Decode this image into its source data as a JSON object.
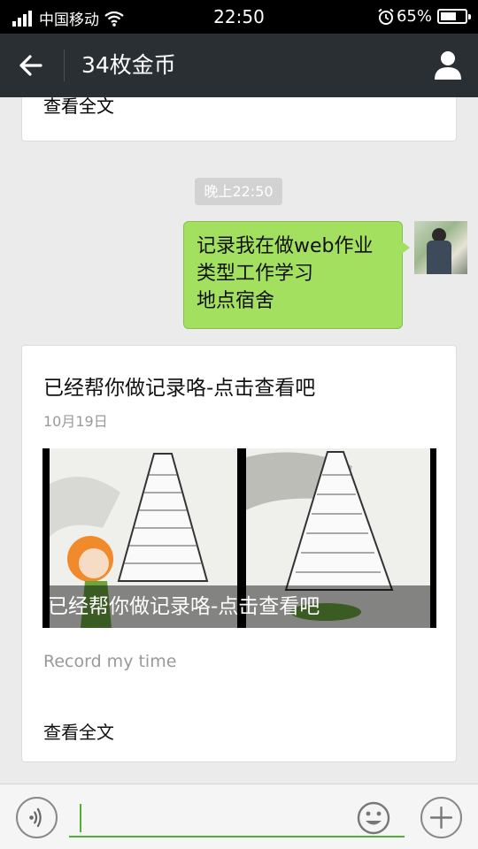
{
  "status_bar": {
    "carrier": "中国移动",
    "time": "22:50",
    "battery": "65%",
    "battery_level": 0.65
  },
  "nav": {
    "title": "34枚金币",
    "back_icon": "back-arrow-icon",
    "profile_icon": "person-icon"
  },
  "messages": {
    "prev_card_more": "查看全文",
    "timestamp": "晚上22:50",
    "sent_lines": [
      "记录我在做web作业",
      "类型工作学习",
      "地点宿舍"
    ],
    "article": {
      "title": "已经帮你做记录咯-点击查看吧",
      "date": "10月19日",
      "image_caption": "已经帮你做记录咯-点击查看吧",
      "description": "Record my time",
      "more": "查看全文"
    }
  },
  "input_bar": {
    "voice_icon": "voice-icon",
    "emoji_icon": "emoji-icon",
    "plus_icon": "plus-icon",
    "value": "",
    "accent": "#4fb033"
  },
  "colors": {
    "nav_bg": "#2a2f33",
    "bubble_green": "#a3e060",
    "chat_bg": "#ebebeb"
  }
}
